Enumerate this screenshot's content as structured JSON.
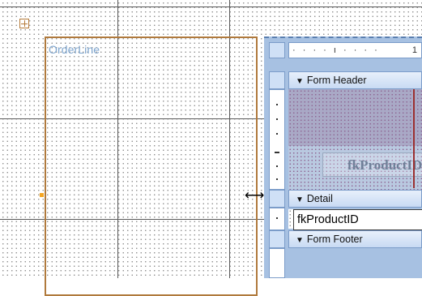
{
  "design": {
    "subform_name": "OrderLine",
    "cursor_symbol": "⟷"
  },
  "embedded_form": {
    "ruler_ticks": "· · · · ı · · · ·",
    "ruler_number": "1",
    "sections": [
      {
        "label": "Form Header",
        "arrow": "▼"
      },
      {
        "label": "Detail",
        "arrow": "▼"
      },
      {
        "label": "Form Footer",
        "arrow": "▼"
      }
    ],
    "header_label": "fkProductID",
    "detail_field": "fkProductID"
  }
}
